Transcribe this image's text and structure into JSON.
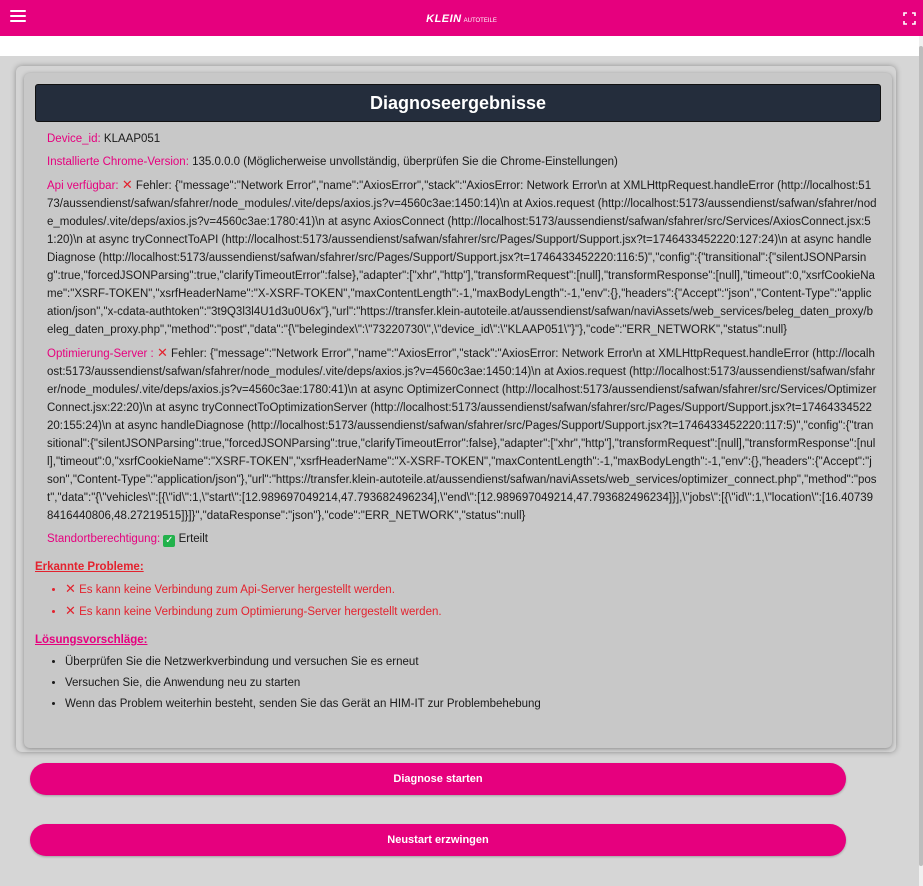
{
  "header": {
    "logo_text": "KLEIN",
    "logo_subtext": "autoteile",
    "accent_color": "#e6007e"
  },
  "card": {
    "title": "Diagnoseergebnisse",
    "device_id": {
      "label": "Device_id:",
      "value": "KLAAP051"
    },
    "chrome_version": {
      "label": "Installierte Chrome-Version:",
      "value": "135.0.0.0 (Möglicherweise unvollständig, überprüfen Sie die Chrome-Einstellungen)"
    },
    "api": {
      "label": "Api verfügbar:",
      "icon": "cross-icon",
      "value": "Fehler: {\"message\":\"Network Error\",\"name\":\"AxiosError\",\"stack\":\"AxiosError: Network Error\\n at XMLHttpRequest.handleError (http://localhost:5173/aussendienst/safwan/sfahrer/node_modules/.vite/deps/axios.js?v=4560c3ae:1450:14)\\n at Axios.request (http://localhost:5173/aussendienst/safwan/sfahrer/node_modules/.vite/deps/axios.js?v=4560c3ae:1780:41)\\n at async AxiosConnect (http://localhost:5173/aussendienst/safwan/sfahrer/src/Services/AxiosConnect.jsx:51:20)\\n at async tryConnectToAPI (http://localhost:5173/aussendienst/safwan/sfahrer/src/Pages/Support/Support.jsx?t=1746433452220:127:24)\\n at async handleDiagnose (http://localhost:5173/aussendienst/safwan/sfahrer/src/Pages/Support/Support.jsx?t=1746433452220:116:5)\",\"config\":{\"transitional\":{\"silentJSONParsing\":true,\"forcedJSONParsing\":true,\"clarifyTimeoutError\":false},\"adapter\":[\"xhr\",\"http\"],\"transformRequest\":[null],\"transformResponse\":[null],\"timeout\":0,\"xsrfCookieName\":\"XSRF-TOKEN\",\"xsrfHeaderName\":\"X-XSRF-TOKEN\",\"maxContentLength\":-1,\"maxBodyLength\":-1,\"env\":{},\"headers\":{\"Accept\":\"json\",\"Content-Type\":\"application/json\",\"x-cdata-authtoken\":\"3t9Q3l3l4U1d3u0U6x\"},\"url\":\"https://transfer.klein-autoteile.at/aussendienst/safwan/naviAssets/web_services/beleg_daten_proxy/beleg_daten_proxy.php\",\"method\":\"post\",\"data\":\"{\\\"belegindex\\\":\\\"73220730\\\",\\\"device_id\\\":\\\"KLAAP051\\\"}\"},\"code\":\"ERR_NETWORK\",\"status\":null}"
    },
    "optimizer": {
      "label": "Optimierung-Server :",
      "icon": "cross-icon",
      "value": "Fehler: {\"message\":\"Network Error\",\"name\":\"AxiosError\",\"stack\":\"AxiosError: Network Error\\n at XMLHttpRequest.handleError (http://localhost:5173/aussendienst/safwan/sfahrer/node_modules/.vite/deps/axios.js?v=4560c3ae:1450:14)\\n at Axios.request (http://localhost:5173/aussendienst/safwan/sfahrer/node_modules/.vite/deps/axios.js?v=4560c3ae:1780:41)\\n at async OptimizerConnect (http://localhost:5173/aussendienst/safwan/sfahrer/src/Services/OptimizerConnect.jsx:22:20)\\n at async tryConnectToOptimizationServer (http://localhost:5173/aussendienst/safwan/sfahrer/src/Pages/Support/Support.jsx?t=1746433452220:155:24)\\n at async handleDiagnose (http://localhost:5173/aussendienst/safwan/sfahrer/src/Pages/Support/Support.jsx?t=1746433452220:117:5)\",\"config\":{\"transitional\":{\"silentJSONParsing\":true,\"forcedJSONParsing\":true,\"clarifyTimeoutError\":false},\"adapter\":[\"xhr\",\"http\"],\"transformRequest\":[null],\"transformResponse\":[null],\"timeout\":0,\"xsrfCookieName\":\"XSRF-TOKEN\",\"xsrfHeaderName\":\"X-XSRF-TOKEN\",\"maxContentLength\":-1,\"maxBodyLength\":-1,\"env\":{},\"headers\":{\"Accept\":\"json\",\"Content-Type\":\"application/json\"},\"url\":\"https://transfer.klein-autoteile.at/aussendienst/safwan/naviAssets/web_services/optimizer_connect.php\",\"method\":\"post\",\"data\":\"{\\\"vehicles\\\":[{\\\"id\\\":1,\\\"start\\\":[12.989697049214,47.793682496234],\\\"end\\\":[12.989697049214,47.793682496234]}],\\\"jobs\\\":[{\\\"id\\\":1,\\\"location\\\":[16.407398416440806,48.27219515]}]}\",\"dataResponse\":\"json\"},\"code\":\"ERR_NETWORK\",\"status\":null}"
    },
    "location": {
      "label": "Standortberechtigung:",
      "icon": "check-icon",
      "value": "Erteilt"
    },
    "problems": {
      "heading": "Erkannte Probleme:",
      "items": [
        "Es kann keine Verbindung zum Api-Server hergestellt werden.",
        "Es kann keine Verbindung zum Optimierung-Server hergestellt werden."
      ]
    },
    "suggestions": {
      "heading": "Lösungsvorschläge:",
      "items": [
        "Überprüfen Sie die Netzwerkverbindung und versuchen Sie es erneut",
        "Versuchen Sie, die Anwendung neu zu starten",
        "Wenn das Problem weiterhin besteht, senden Sie das Gerät an HIM-IT zur Problembehebung"
      ]
    }
  },
  "buttons": {
    "start_diagnose": "Diagnose starten",
    "force_restart": "Neustart erzwingen"
  }
}
